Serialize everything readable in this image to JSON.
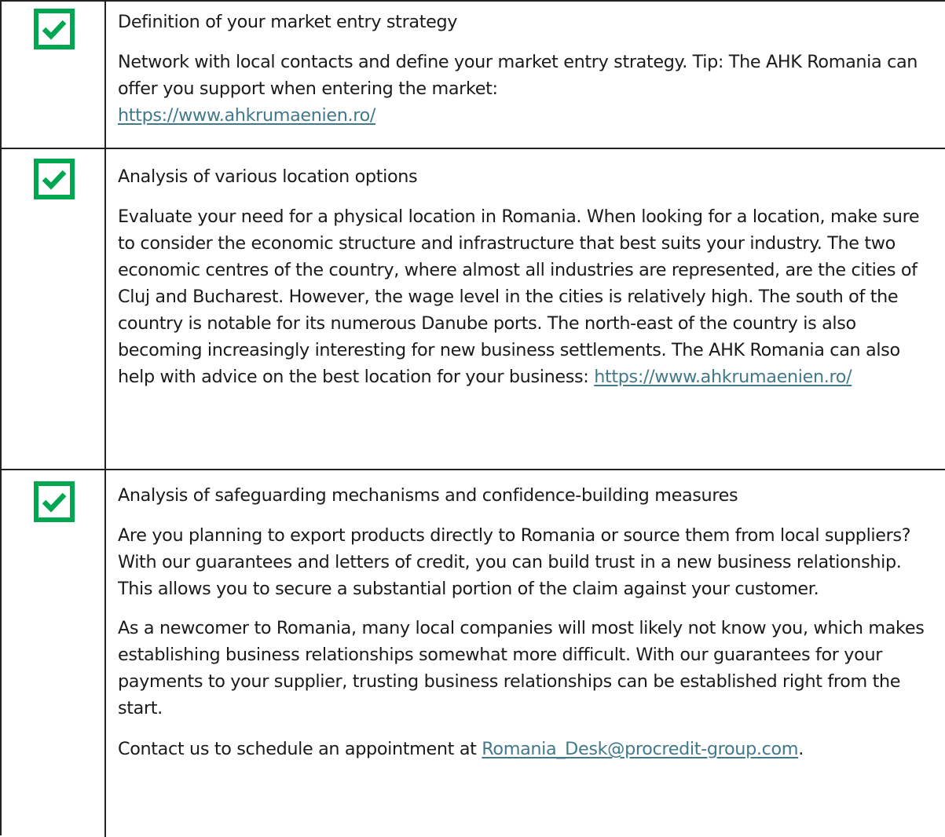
{
  "colors": {
    "check_green": "#00a650",
    "link": "#41798b",
    "border": "#222222"
  },
  "rows": [
    {
      "icon": "checked-box-icon",
      "title": "Definition of your market entry strategy",
      "body_text": "Network with local contacts and define your market entry strategy. Tip: The AHK Romania can offer you support when entering the market:",
      "link_text": "https://www.ahkrumaenien.ro/"
    },
    {
      "icon": "checked-box-icon",
      "title": "Analysis of various location options",
      "body_text": "Evaluate your need for a physical location in Romania. When looking for a location, make sure to consider the economic structure and infrastructure that best suits your industry. The two economic centres of the country, where almost all industries are represented, are the cities of Cluj and Bucharest. However, the wage level in the cities is relatively high. The south of the country is notable for its numerous Danube ports. The north-east of the country is also becoming increasingly interesting for new business settlements. The AHK Romania can also help with advice on the best location for your business:",
      "link_text": "https://www.ahkrumaenien.ro/"
    },
    {
      "icon": "checked-box-icon",
      "title": "Analysis of safeguarding mechanisms and confidence-building measures",
      "para1": "Are you planning to export products directly to Romania or source them from local suppliers? With our guarantees and letters of credit, you can build trust in a new business relationship. This allows you to secure a substantial portion of the claim against your customer.",
      "para2": "As a newcomer to Romania, many local companies will most likely not know you, which makes establishing business relationships somewhat more difficult. With our guarantees for your payments to your supplier, trusting business relationships can be established right from the start.",
      "contact_text": "Contact us to schedule an appointment at",
      "email_text": "Romania_Desk@procredit-group.com",
      "trailing": "."
    }
  ]
}
